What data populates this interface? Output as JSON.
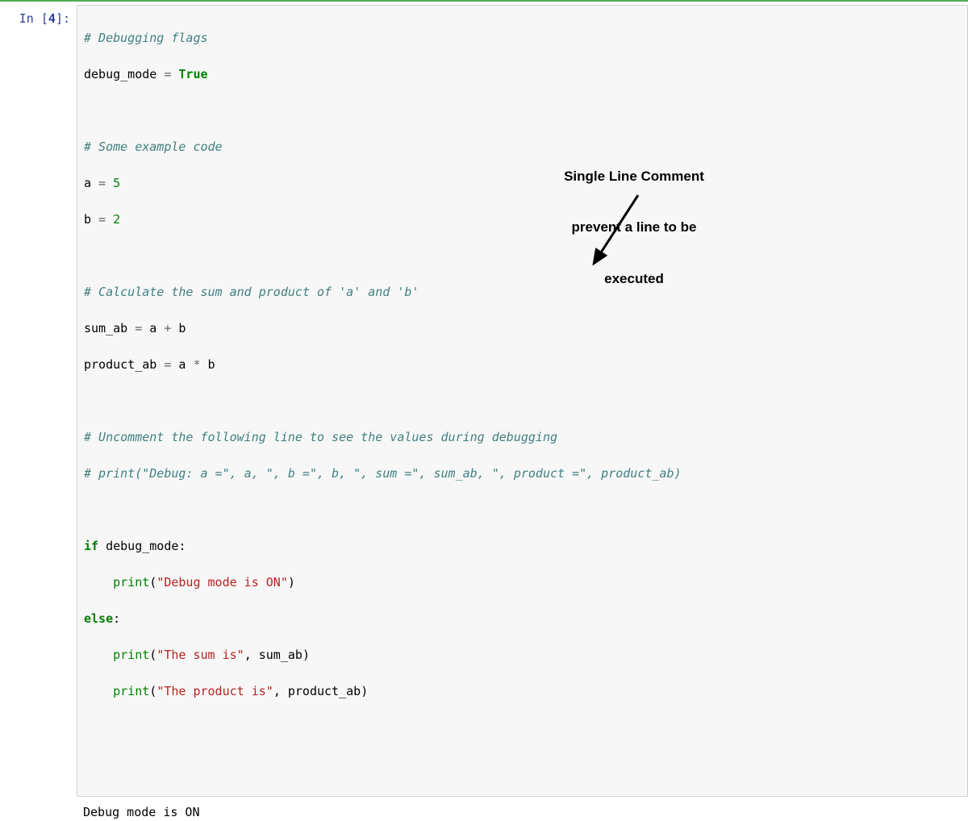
{
  "prompt": {
    "prefix": "In [",
    "num": "4",
    "suffix": "]:"
  },
  "code": {
    "l1_comment": "# Debugging flags",
    "l2_name": "debug_mode",
    "l2_op": " = ",
    "l2_val": "True",
    "l4_comment": "# Some example code",
    "l5_name": "a",
    "l5_op": " = ",
    "l5_val": "5",
    "l6_name": "b",
    "l6_op": " = ",
    "l6_val": "2",
    "l8_comment": "# Calculate the sum and product of 'a' and 'b'",
    "l9_name": "sum_ab",
    "l9_eq": " = ",
    "l9_a": "a",
    "l9_plus": " + ",
    "l9_b": "b",
    "l10_name": "product_ab",
    "l10_eq": " = ",
    "l10_a": "a",
    "l10_mul": " * ",
    "l10_b": "b",
    "l12_comment": "# Uncomment the following line to see the values during debugging",
    "l13_comment": "# print(\"Debug: a =\", a, \", b =\", b, \", sum =\", sum_ab, \", product =\", product_ab)",
    "l15_if": "if",
    "l15_sp": " ",
    "l15_name": "debug_mode",
    "l15_colon": ":",
    "l16_indent": "    ",
    "l16_print": "print",
    "l16_open": "(",
    "l16_str": "\"Debug mode is ON\"",
    "l16_close": ")",
    "l17_else": "else",
    "l17_colon": ":",
    "l18_indent": "    ",
    "l18_print": "print",
    "l18_open": "(",
    "l18_str": "\"The sum is\"",
    "l18_comma": ", ",
    "l18_var": "sum_ab",
    "l18_close": ")",
    "l19_indent": "    ",
    "l19_print": "print",
    "l19_open": "(",
    "l19_str": "\"The product is\"",
    "l19_comma": ", ",
    "l19_var": "product_ab",
    "l19_close": ")"
  },
  "output": {
    "text": "Debug mode is ON"
  },
  "annotation": {
    "line1": "Single Line Comment",
    "line2": "prevent a line to be",
    "line3": "executed"
  }
}
